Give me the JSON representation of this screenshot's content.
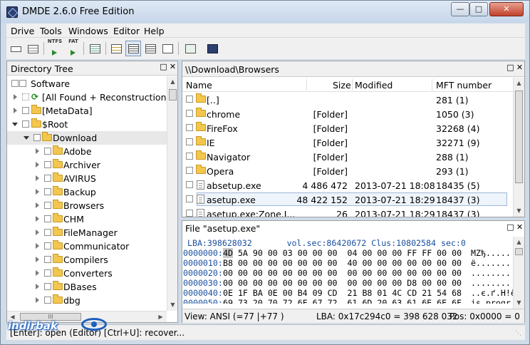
{
  "window": {
    "title": "DMDE 2.6.0 Free Edition",
    "controls": [
      "minimize",
      "maximize",
      "close"
    ]
  },
  "menu": [
    "Drive",
    "Tools",
    "Windows",
    "Editor",
    "Help"
  ],
  "toolbar": {
    "ntfs_label": "NTFS",
    "fat_label": "FAT"
  },
  "directory_tree": {
    "title": "Directory Tree",
    "items": [
      {
        "label": "Software"
      },
      {
        "label": "[All Found + Reconstruction]"
      },
      {
        "label": "[MetaData]"
      },
      {
        "label": "$Root"
      },
      {
        "label": "Download"
      },
      {
        "label": "Adobe"
      },
      {
        "label": "Archiver"
      },
      {
        "label": "AVIRUS"
      },
      {
        "label": "Backup"
      },
      {
        "label": "Browsers"
      },
      {
        "label": "CHM"
      },
      {
        "label": "FileManager"
      },
      {
        "label": "Communicator"
      },
      {
        "label": "Compilers"
      },
      {
        "label": "Converters"
      },
      {
        "label": "DBases"
      },
      {
        "label": "dbg"
      }
    ],
    "hscroll_thumb": "III"
  },
  "file_list": {
    "path": "\\\\Download\\Browsers",
    "columns": {
      "name": "Name",
      "size": "Size",
      "modified": "Modified",
      "mft": "MFT number"
    },
    "rows": [
      {
        "name": "[..]",
        "size": "",
        "modified": "",
        "mft": "281 (1)"
      },
      {
        "name": "chrome",
        "size": "[Folder]",
        "modified": "",
        "mft": "1050 (3)"
      },
      {
        "name": "FireFox",
        "size": "[Folder]",
        "modified": "",
        "mft": "32268 (4)"
      },
      {
        "name": "IE",
        "size": "[Folder]",
        "modified": "",
        "mft": "32271 (9)"
      },
      {
        "name": "Navigator",
        "size": "[Folder]",
        "modified": "",
        "mft": "288 (1)"
      },
      {
        "name": "Opera",
        "size": "[Folder]",
        "modified": "",
        "mft": "293 (1)"
      },
      {
        "name": "absetup.exe",
        "size": "4 486 472",
        "modified": "2013-07-21 18:08",
        "mft": "18435 (5)"
      },
      {
        "name": "asetup.exe",
        "size": "48 422 152",
        "modified": "2013-07-21 18:29",
        "mft": "18437 (3)"
      },
      {
        "name": "asetup.exe:Zone.I...",
        "size": "26",
        "modified": "2013-07-21 18:29",
        "mft": "18437 (3)"
      }
    ]
  },
  "hex_editor": {
    "title": "File \"asetup.exe\"",
    "info_line": " LBA:398628032       vol.sec:86420672 Clus:10802584 sec:0",
    "lines": [
      {
        "offset": "0000000:",
        "cursor": "4D",
        "bytes": " 5A 90 00 03 00 00 00  04 00 00 00 FF FF 00 00",
        "ascii": "MZђ....."
      },
      {
        "offset": "0000010:",
        "bytes": "B8 00 00 00 00 00 00 00  40 00 00 00 00 00 00 00",
        "ascii": "ё......."
      },
      {
        "offset": "0000020:",
        "bytes": "00 00 00 00 00 00 00 00  00 00 00 00 00 00 00 00",
        "ascii": "........"
      },
      {
        "offset": "0000030:",
        "bytes": "00 00 00 00 00 00 00 00  00 00 00 00 D8 00 00 00",
        "ascii": "........"
      },
      {
        "offset": "0000040:",
        "bytes": "0E 1F BA 0E 00 B4 09 CD  21 B8 01 4C CD 21 54 68",
        "ascii": "..є.ґ.Н!ё.LН!Th"
      },
      {
        "offset": "0000050:",
        "bytes": "69 73 20 70 72 6F 67 72  61 6D 20 63 61 6E 6E 6F",
        "ascii": "is progr"
      }
    ],
    "status": {
      "view": "View: ANSI (=77 |+77 )",
      "lba": "LBA: 0x17c294c0 = 398 628 032",
      "pos": "Pos: 0x0000 = 0"
    }
  },
  "statusbar": {
    "text": "[Enter]: open (Editor)  [Ctrl+U]: recover...",
    "watermark": "indirbak"
  }
}
